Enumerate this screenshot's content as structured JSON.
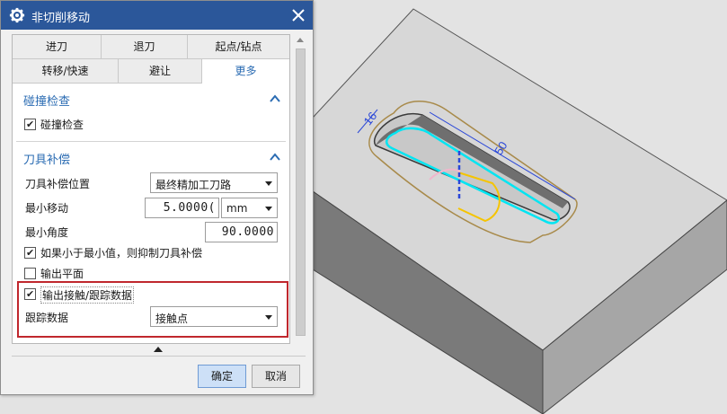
{
  "dialog": {
    "title": "非切削移动",
    "close_icon": "close-icon",
    "settings_icon": "gear-icon"
  },
  "tabs": {
    "row1": [
      "进刀",
      "退刀",
      "起点/钻点"
    ],
    "row2": [
      "转移/快速",
      "避让",
      "更多"
    ],
    "active": "更多"
  },
  "collision_section": {
    "title": "碰撞检查",
    "checkbox_label": "碰撞检查",
    "checked": true
  },
  "tool_comp_section": {
    "title": "刀具补偿",
    "position_label": "刀具补偿位置",
    "position_value": "最终精加工刀路",
    "min_move_label": "最小移动",
    "min_move_value": "5.0000(",
    "min_move_unit": "mm",
    "min_angle_label": "最小角度",
    "min_angle_value": "90.0000",
    "suppress_label": "如果小于最小值，则抑制刀具补偿",
    "suppress_checked": true,
    "output_plane_label": "输出平面",
    "output_plane_checked": false,
    "output_contact_label": "输出接触/跟踪数据",
    "output_contact_checked": true,
    "tracking_label": "跟踪数据",
    "tracking_value": "接触点"
  },
  "buttons": {
    "ok": "确定",
    "cancel": "取消"
  },
  "viewport": {
    "dim_width_label": "16",
    "dim_length_label": "50",
    "colors": {
      "accent": "#2b6cb3",
      "titlebar": "#2b579a",
      "highlight": "#c0272d",
      "toolpath_cyan": "#00e5f2",
      "toolpath_yellow": "#f5c400",
      "dimension_blue": "#2a47d8",
      "boundary_tan": "#a88a4a"
    }
  }
}
